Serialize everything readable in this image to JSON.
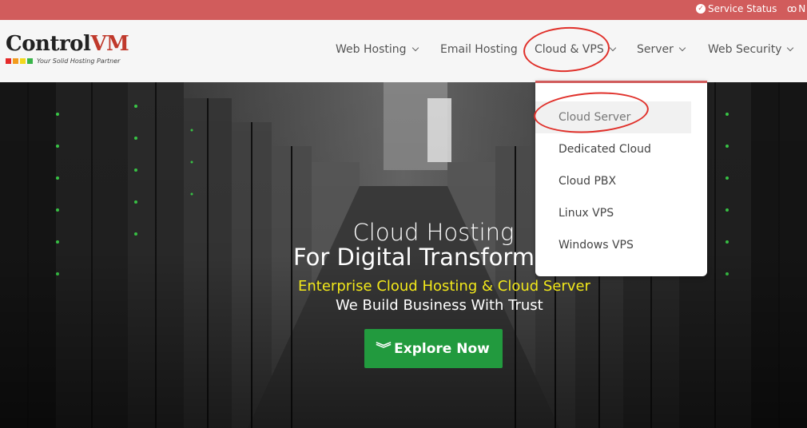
{
  "topbar": {
    "service_status": "Service Status",
    "partial_label": "N"
  },
  "logo": {
    "word_main": "Control",
    "word_accent": "VM",
    "tagline": "Your Solid Hosting Partner",
    "square_colors": [
      "#e52a2a",
      "#f29b1d",
      "#f2d81d",
      "#3ab54a"
    ]
  },
  "nav": {
    "items": [
      {
        "label": "Web Hosting",
        "has_dropdown": true
      },
      {
        "label": "Email Hosting",
        "has_dropdown": false
      },
      {
        "label": "Cloud & VPS",
        "has_dropdown": true
      },
      {
        "label": "Server",
        "has_dropdown": true
      },
      {
        "label": "Web Security",
        "has_dropdown": true
      }
    ]
  },
  "dropdown": {
    "items": [
      {
        "label": "Cloud Server",
        "active": true
      },
      {
        "label": "Dedicated Cloud",
        "active": false
      },
      {
        "label": "Cloud PBX",
        "active": false
      },
      {
        "label": "Linux VPS",
        "active": false
      },
      {
        "label": "Windows VPS",
        "active": false
      }
    ]
  },
  "hero": {
    "title_line1": "Cloud Hosting",
    "title_line2": "For Digital Transformat",
    "subtitle": "Enterprise Cloud Hosting & Cloud Server",
    "tagline": "We Build Business With Trust",
    "cta_label": "Explore Now"
  },
  "colors": {
    "topbar": "#d15c5c",
    "accent_yellow": "#f2e81a",
    "cta_green": "#229a3e",
    "annotation_red": "#e0302a"
  }
}
